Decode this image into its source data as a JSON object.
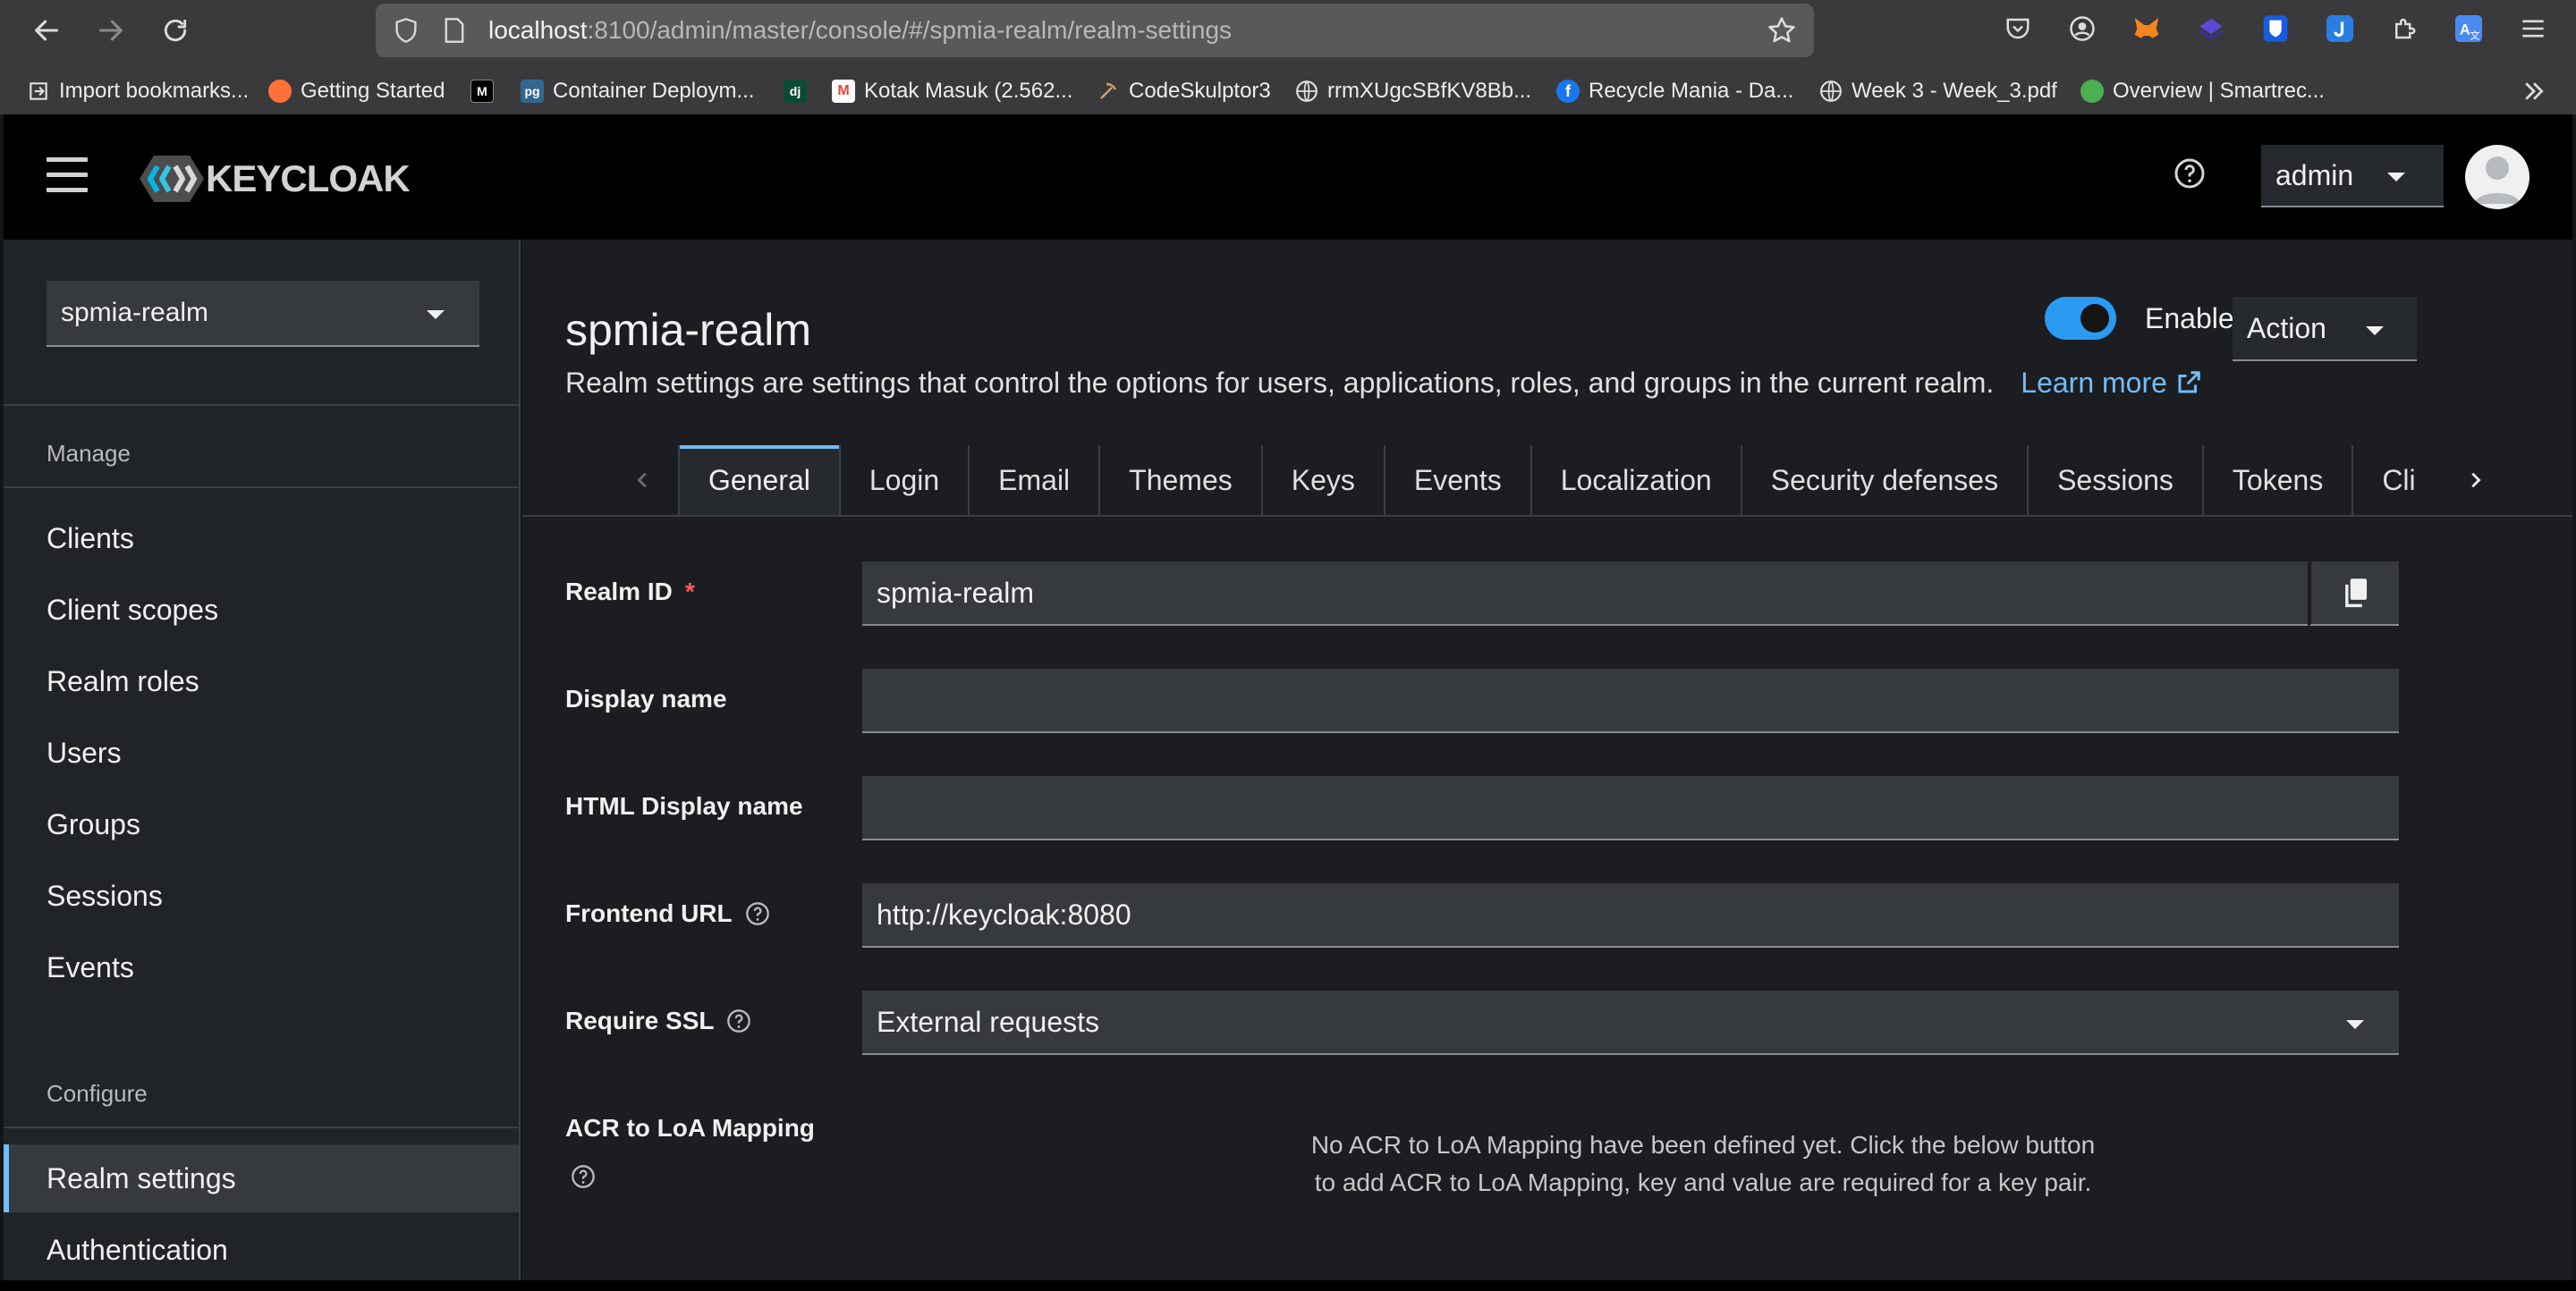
{
  "browser": {
    "url_host": "localhost",
    "url_rest": ":8100/admin/master/console/#/spmia-realm/realm-settings",
    "bookmarks": [
      {
        "label": "Import bookmarks...",
        "icon": "import-icon",
        "color": "#3a3a3c"
      },
      {
        "label": "Getting Started",
        "icon": "firefox-icon",
        "color": "#ff7139"
      },
      {
        "label": "",
        "icon": "medium-icon",
        "color": "#000000"
      },
      {
        "label": "Container Deploym...",
        "icon": "postgres-icon",
        "color": "#336791"
      },
      {
        "label": "",
        "icon": "django-icon",
        "color": "#0c4b33"
      },
      {
        "label": "Kotak Masuk (2.562...",
        "icon": "gmail-icon",
        "color": "#ea4335"
      },
      {
        "label": "CodeSkulptor3",
        "icon": "pickaxe-icon",
        "color": "#8a6d3b"
      },
      {
        "label": "rrmXUgcSBfKV8Bb...",
        "icon": "globe-icon",
        "color": "#3a3a3c"
      },
      {
        "label": "Recycle Mania - Da...",
        "icon": "facebook-icon",
        "color": "#1877f2"
      },
      {
        "label": "Week 3 - Week_3.pdf",
        "icon": "globe-icon",
        "color": "#3a3a3c"
      },
      {
        "label": "Overview | Smartrec...",
        "icon": "shield-green-icon",
        "color": "#4caf50"
      }
    ]
  },
  "header": {
    "logo_text": "KEYCLOAK",
    "user": "admin"
  },
  "sidebar": {
    "realm": "spmia-realm",
    "manage_label": "Manage",
    "manage_items": [
      "Clients",
      "Client scopes",
      "Realm roles",
      "Users",
      "Groups",
      "Sessions",
      "Events"
    ],
    "configure_label": "Configure",
    "configure_items": [
      "Realm settings",
      "Authentication"
    ]
  },
  "main": {
    "title": "spmia-realm",
    "description": "Realm settings are settings that control the options for users, applications, roles, and groups in the current realm.",
    "learn_more": "Learn more",
    "enabled_label": "Enabled",
    "enabled": true,
    "action_label": "Action",
    "tabs": [
      "General",
      "Login",
      "Email",
      "Themes",
      "Keys",
      "Events",
      "Localization",
      "Security defenses",
      "Sessions",
      "Tokens",
      "Client policies"
    ],
    "active_tab": "General",
    "form": {
      "realm_id_label": "Realm ID",
      "realm_id_value": "spmia-realm",
      "display_name_label": "Display name",
      "display_name_value": "",
      "html_display_name_label": "HTML Display name",
      "html_display_name_value": "",
      "frontend_url_label": "Frontend URL",
      "frontend_url_value": "http://keycloak:8080",
      "require_ssl_label": "Require SSL",
      "require_ssl_value": "External requests",
      "acr_label": "ACR to LoA Mapping",
      "acr_empty_message": "No ACR to LoA Mapping have been defined yet. Click the below button to add ACR to LoA Mapping, key and value are required for a key pair."
    }
  },
  "colors": {
    "accent": "#73bcf7",
    "toggle_on": "#2b9af3",
    "required": "#ff5a5a"
  }
}
